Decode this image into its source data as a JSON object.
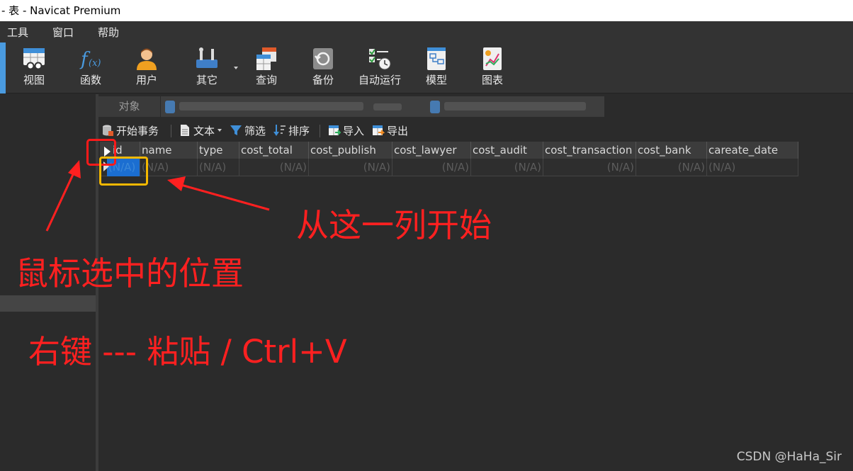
{
  "window": {
    "title": "- 表 - Navicat Premium"
  },
  "menu": {
    "items": [
      "工具",
      "窗口",
      "帮助"
    ]
  },
  "toolbar": {
    "items": [
      {
        "label": "视图",
        "icon": "view-icon"
      },
      {
        "label": "函数",
        "icon": "function-icon"
      },
      {
        "label": "用户",
        "icon": "user-icon"
      },
      {
        "label": "其它",
        "icon": "tools-icon"
      },
      {
        "label": "查询",
        "icon": "query-icon"
      },
      {
        "label": "备份",
        "icon": "backup-icon"
      },
      {
        "label": "自动运行",
        "icon": "schedule-icon"
      },
      {
        "label": "模型",
        "icon": "model-icon"
      },
      {
        "label": "图表",
        "icon": "chart-icon"
      }
    ]
  },
  "tabs": {
    "objects_label": "对象"
  },
  "object_toolbar": {
    "begin_transaction": "开始事务",
    "text": "文本",
    "filter": "筛选",
    "sort": "排序",
    "import": "导入",
    "export": "导出"
  },
  "grid": {
    "columns": [
      "id",
      "name",
      "type",
      "cost_total",
      "cost_publish",
      "cost_lawyer",
      "cost_audit",
      "cost_transaction",
      "cost_bank",
      "careate_date"
    ],
    "row": [
      "(N/A)",
      "(N/A)",
      "(N/A)",
      "(N/A)",
      "(N/A)",
      "(N/A)",
      "(N/A)",
      "(N/A)",
      "(N/A)",
      "(N/A)"
    ]
  },
  "annotations": {
    "start_column": "从这一列开始",
    "mouse_position": "鼠标选中的位置",
    "paste_hint": "右键 --- 粘贴 / Ctrl+V"
  },
  "colors": {
    "annotation_red": "#ff2020",
    "highlight_yellow": "#f5b800",
    "selection_blue": "#1b6ed1"
  },
  "watermark": "CSDN @HaHa_Sir"
}
